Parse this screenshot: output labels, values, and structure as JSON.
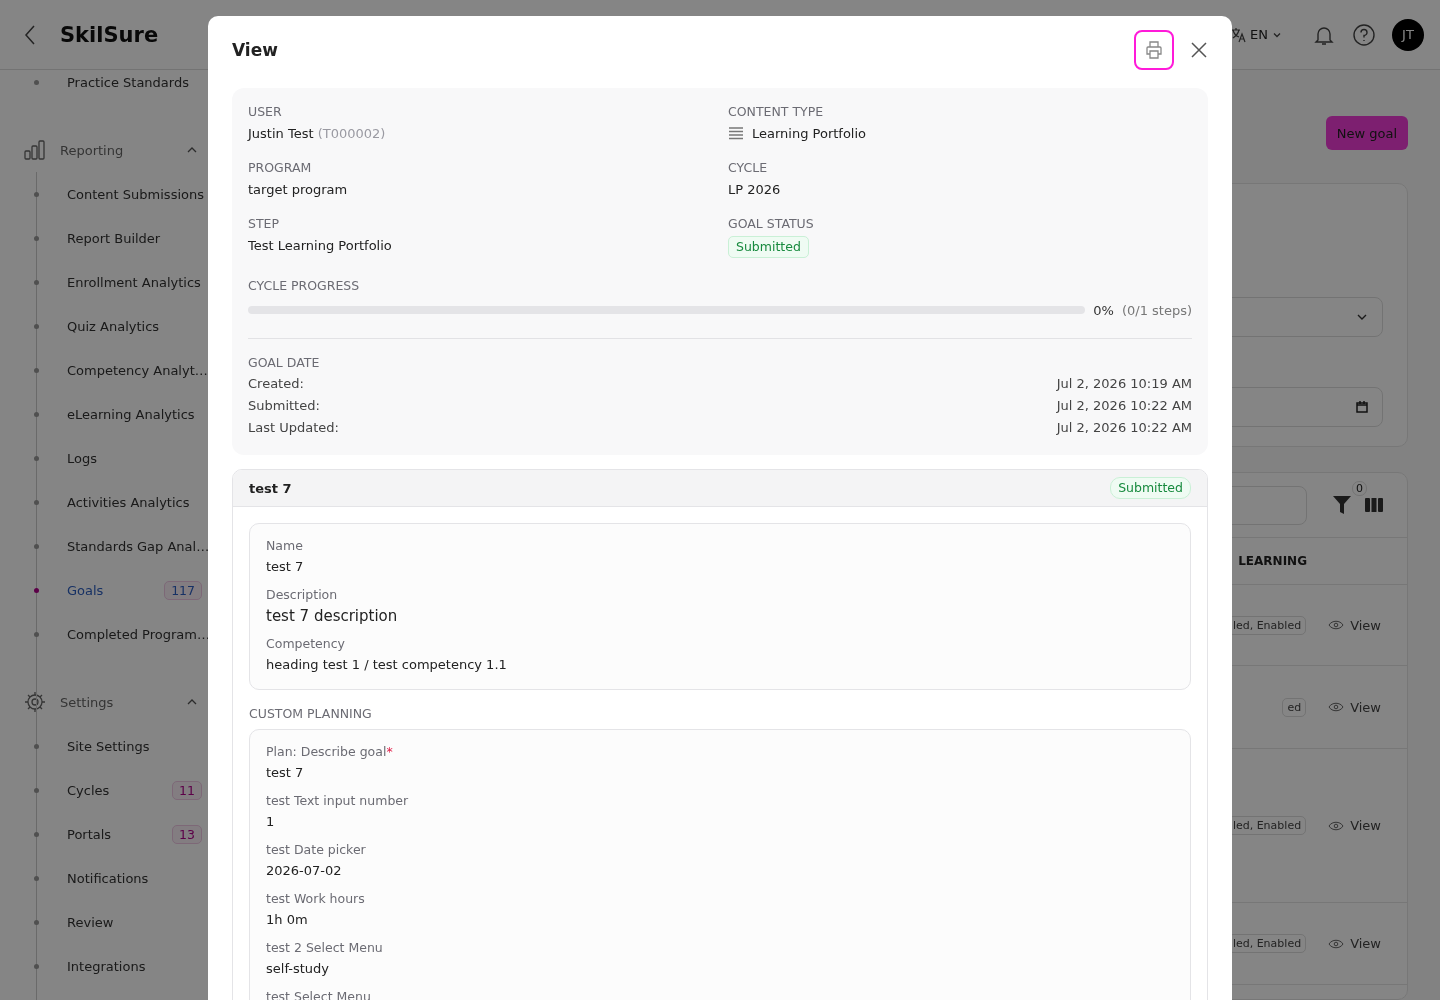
{
  "app": {
    "logo": "SkilSure",
    "language": "EN",
    "avatar": "JT"
  },
  "sidebar": {
    "top_items": [
      {
        "label": "Practice Standards",
        "selected": false
      }
    ],
    "groups": [
      {
        "label": "Reporting",
        "expanded": true,
        "children": [
          {
            "label": "Content Submissions",
            "selected": false
          },
          {
            "label": "Report Builder",
            "selected": false
          },
          {
            "label": "Enrollment Analytics",
            "selected": false
          },
          {
            "label": "Quiz Analytics",
            "selected": false
          },
          {
            "label": "Competency Analyt…",
            "selected": false
          },
          {
            "label": "eLearning Analytics",
            "selected": false
          },
          {
            "label": "Logs",
            "selected": false
          },
          {
            "label": "Activities Analytics",
            "selected": false
          },
          {
            "label": "Standards Gap Anal…",
            "selected": false
          },
          {
            "label": "Goals",
            "selected": true,
            "badge": "117"
          },
          {
            "label": "Completed Program…",
            "selected": false
          }
        ]
      },
      {
        "label": "Settings",
        "expanded": true,
        "children": [
          {
            "label": "Site Settings",
            "selected": false
          },
          {
            "label": "Cycles",
            "selected": false,
            "badge": "11"
          },
          {
            "label": "Portals",
            "selected": false,
            "badge": "13"
          },
          {
            "label": "Notifications",
            "selected": false
          },
          {
            "label": "Review",
            "selected": false
          },
          {
            "label": "Integrations",
            "selected": false
          }
        ]
      }
    ]
  },
  "main": {
    "new_goal_button": "New goal",
    "table": {
      "filter_count": "0",
      "column_header": "LEARNING",
      "rows": [
        {
          "status": "led, Enabled",
          "action": "View"
        },
        {
          "status": "ed",
          "action": "View"
        },
        {
          "status": "led, Enabled",
          "action": "View"
        },
        {
          "status": "led, Enabled",
          "action": "View"
        }
      ]
    }
  },
  "modal": {
    "title": "View",
    "summary": {
      "fields": [
        {
          "kind": "user",
          "label": "USER",
          "value": "Justin Test",
          "secondary": "(T000002)"
        },
        {
          "kind": "content_type",
          "label": "CONTENT TYPE",
          "value": "Learning Portfolio"
        },
        {
          "kind": "text",
          "label": "PROGRAM",
          "value": "target program"
        },
        {
          "kind": "text",
          "label": "CYCLE",
          "value": "LP 2026"
        },
        {
          "kind": "text",
          "label": "STEP",
          "value": "Test Learning Portfolio"
        },
        {
          "kind": "status",
          "label": "GOAL STATUS",
          "value": "Submitted"
        }
      ],
      "progress": {
        "label": "CYCLE PROGRESS",
        "level": 0,
        "percent": "0%",
        "steps": "(0/1 steps)"
      },
      "dates": {
        "label": "GOAL DATE",
        "rows": [
          {
            "label": "Created:",
            "value": "Jul 2, 2026 10:19 AM"
          },
          {
            "label": "Submitted:",
            "value": "Jul 2, 2026 10:22 AM"
          },
          {
            "label": "Last Updated:",
            "value": "Jul 2, 2026 10:22 AM"
          }
        ]
      }
    },
    "goal": {
      "title": "test 7",
      "status": "Submitted",
      "details": [
        {
          "label": "Name",
          "value": "test 7",
          "kind": "normal"
        },
        {
          "label": "Description",
          "value": "test 7 description",
          "kind": "large"
        },
        {
          "label": "Competency",
          "value": "heading test 1 / test competency 1.1",
          "kind": "normal"
        }
      ],
      "section_title": "CUSTOM PLANNING",
      "plan": [
        {
          "label": "Plan: Describe goal",
          "marker": "*",
          "value": "test 7"
        },
        {
          "label": "test Text input number",
          "value": "1"
        },
        {
          "label": "test Date picker",
          "value": "2026-07-02"
        },
        {
          "label": "test Work hours",
          "value": "1h 0m"
        },
        {
          "label": "test 2 Select Menu",
          "value": "self-study"
        },
        {
          "label": "test Select Menu"
        }
      ]
    }
  }
}
